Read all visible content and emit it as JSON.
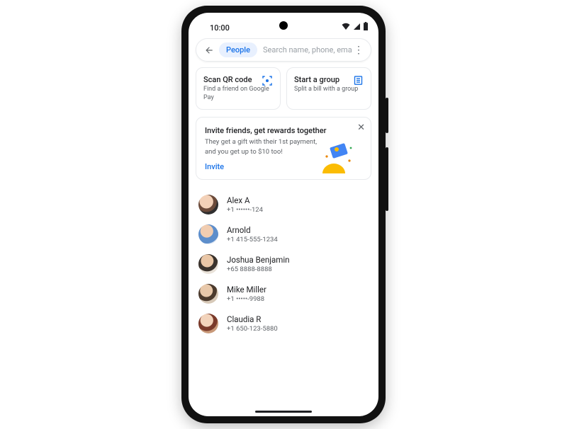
{
  "status": {
    "time": "10:00"
  },
  "search": {
    "chip": "People",
    "placeholder": "Search name, phone, email"
  },
  "actions": {
    "scan": {
      "title": "Scan QR code",
      "subtitle": "Find a friend on Google Pay"
    },
    "group": {
      "title": "Start a group",
      "subtitle": "Split a bill with a group"
    }
  },
  "promo": {
    "title": "Invite friends, get rewards together",
    "body": "They get a gift with their 1st payment, and you get up to $10 too!",
    "cta": "Invite"
  },
  "contacts": [
    {
      "name": "Alex A",
      "phone": "+1 ••••••-124"
    },
    {
      "name": "Arnold",
      "phone": "+1 415-555-1234"
    },
    {
      "name": "Joshua Benjamin",
      "phone": "+65 8888-8888"
    },
    {
      "name": "Mike Miller",
      "phone": "+1 •••••-9988"
    },
    {
      "name": "Claudia R",
      "phone": "+1 650-123-5880"
    }
  ]
}
